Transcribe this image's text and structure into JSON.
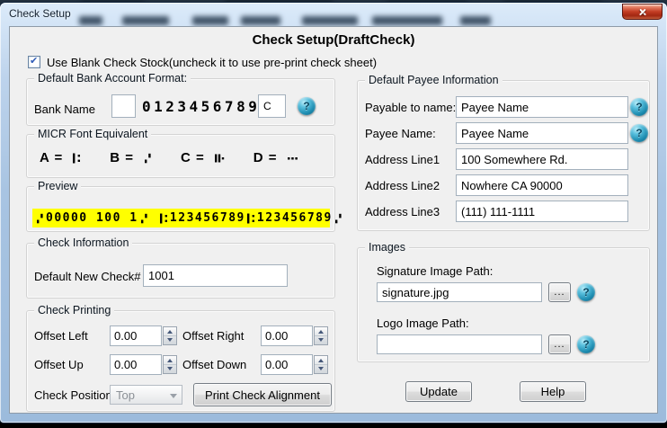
{
  "window": {
    "title": "Check Setup"
  },
  "heading": "Check Setup(DraftCheck)",
  "stock_checkbox": {
    "label": "Use Blank Check Stock(uncheck it to use pre-print check sheet)",
    "checked": true
  },
  "bank_format": {
    "group_title": "Default Bank Account Format:",
    "bank_name_label": "Bank Name",
    "bank_name_value": "",
    "micr_digits": "0123456789",
    "check_digit_value": "C"
  },
  "micr_equiv": {
    "group_title": "MICR Font Equivalent",
    "items": [
      {
        "label": "A =",
        "symbol": "transit"
      },
      {
        "label": "B =",
        "symbol": "onus"
      },
      {
        "label": "C =",
        "symbol": "amount"
      },
      {
        "label": "D =",
        "symbol": "dash"
      }
    ]
  },
  "preview": {
    "group_title": "Preview",
    "highlight_color": "#ffff00",
    "segments": [
      {
        "sym": "onus"
      },
      {
        "text": "00000 100 1"
      },
      {
        "sym": "onus"
      },
      {
        "text": " "
      },
      {
        "sym": "transit"
      },
      {
        "text": "123456789"
      },
      {
        "sym": "transit"
      },
      {
        "text": "123456789"
      },
      {
        "sym": "onus"
      }
    ]
  },
  "check_info": {
    "group_title": "Check Information",
    "label": "Default New Check#",
    "value": "1001"
  },
  "check_printing": {
    "group_title": "Check Printing",
    "fields": [
      {
        "label": "Offset Left",
        "value": "0.00"
      },
      {
        "label": "Offset Right",
        "value": "0.00"
      },
      {
        "label": "Offset Up",
        "value": "0.00"
      },
      {
        "label": "Offset Down",
        "value": "0.00"
      }
    ],
    "position_label": "Check Position",
    "position_value": "Top",
    "print_button": "Print Check Alignment"
  },
  "payee": {
    "group_title": "Default Payee Information",
    "rows": [
      {
        "label": "Payable to name:",
        "value": "Payee Name",
        "help": true
      },
      {
        "label": "Payee Name:",
        "value": "Payee Name",
        "help": true
      },
      {
        "label": "Address Line1",
        "value": "100 Somewhere Rd."
      },
      {
        "label": "Address Line2",
        "value": "Nowhere CA 90000"
      },
      {
        "label": "Address Line3",
        "value": "(111) 111-1111"
      }
    ]
  },
  "images": {
    "group_title": "Images",
    "signature_label": "Signature Image Path:",
    "signature_value": "signature.jpg",
    "logo_label": "Logo Image Path:",
    "logo_value": "",
    "browse_label": "..."
  },
  "actions": {
    "update": "Update",
    "help": "Help"
  },
  "icons": {
    "close": "close-icon",
    "help": "help-question-sphere-icon",
    "micr_symbols": [
      "transit-symbol",
      "onus-symbol",
      "amount-symbol",
      "dash-symbol"
    ]
  },
  "colors": {
    "preview_highlight": "#ffff00",
    "help_sphere": "#1d8cb0",
    "close_button_red": "#c23c23",
    "titlebar_glass": "#b4cce8",
    "client_background": "#f0f0f0"
  }
}
